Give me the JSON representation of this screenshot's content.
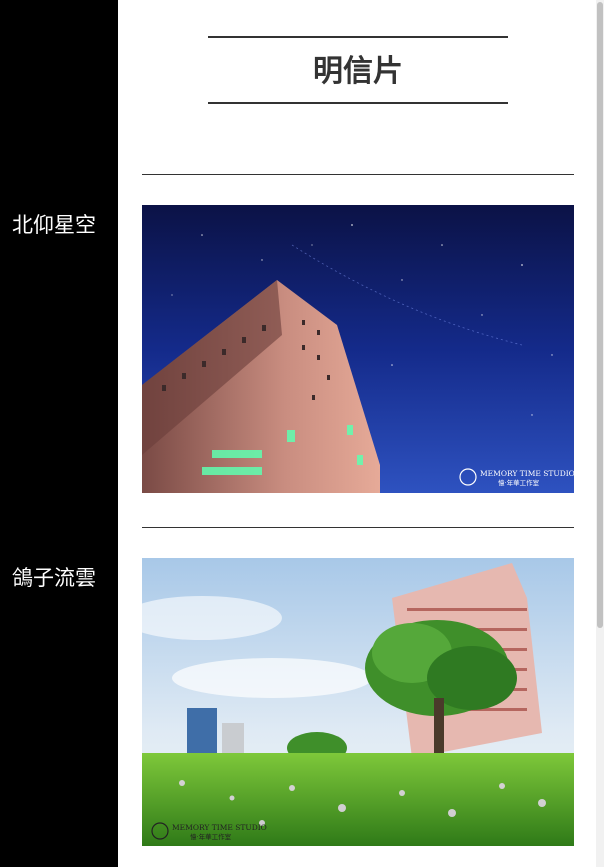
{
  "page": {
    "title": "明信片"
  },
  "sidebar": {
    "items": [
      {
        "label": "北仰星空"
      },
      {
        "label": "鴿子流雲"
      }
    ]
  },
  "postcards": [
    {
      "image": "night-sky-building-photo",
      "watermark_en": "MEMORY TIME STUDIO",
      "watermark_cn": "憶·年華工作室"
    },
    {
      "image": "daytime-lawn-tree-building-photo",
      "watermark_en": "MEMORY TIME STUDIO",
      "watermark_cn": "憶·年華工作室"
    }
  ],
  "colors": {
    "sidebar_bg": "#000000",
    "sidebar_text": "#ffffff",
    "title_text": "#333333",
    "rule": "#333333"
  }
}
